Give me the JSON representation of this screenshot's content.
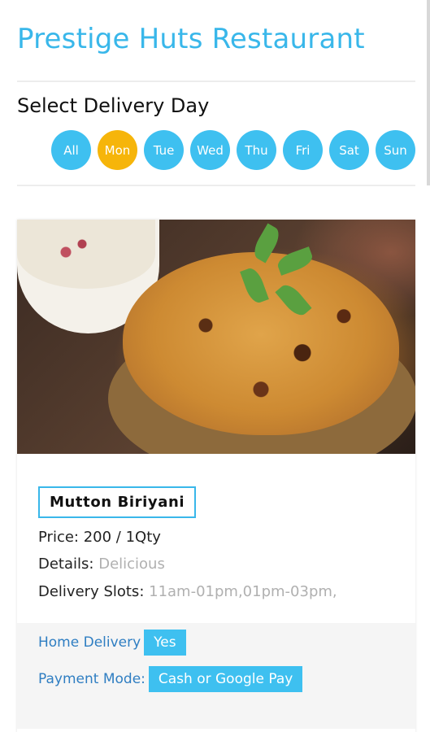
{
  "header": {
    "title": "Prestige Huts Restaurant"
  },
  "delivery": {
    "heading": "Select Delivery Day",
    "days": [
      {
        "label": "All",
        "active": false
      },
      {
        "label": "Mon",
        "active": true
      },
      {
        "label": "Tue",
        "active": false
      },
      {
        "label": "Wed",
        "active": false
      },
      {
        "label": "Thu",
        "active": false
      },
      {
        "label": "Fri",
        "active": false
      },
      {
        "label": "Sat",
        "active": false
      },
      {
        "label": "Sun",
        "active": false
      }
    ]
  },
  "item": {
    "name": "Mutton Biriyani",
    "price_label": "Price:",
    "price_value": "200 / 1Qty",
    "details_label": "Details:",
    "details_value": "Delicious",
    "slots_label": "Delivery Slots:",
    "slots_value": "11am-01pm,01pm-03pm,",
    "home_delivery_label": "Home Delivery",
    "home_delivery_value": "Yes",
    "payment_label": "Payment Mode:",
    "payment_value": "Cash or Google Pay"
  },
  "colors": {
    "accent": "#39b7ea",
    "active_day": "#f6b50a",
    "link_blue": "#2f7ec2"
  },
  "icons": {
    "food_image": "mutton-biriyani-photo"
  }
}
